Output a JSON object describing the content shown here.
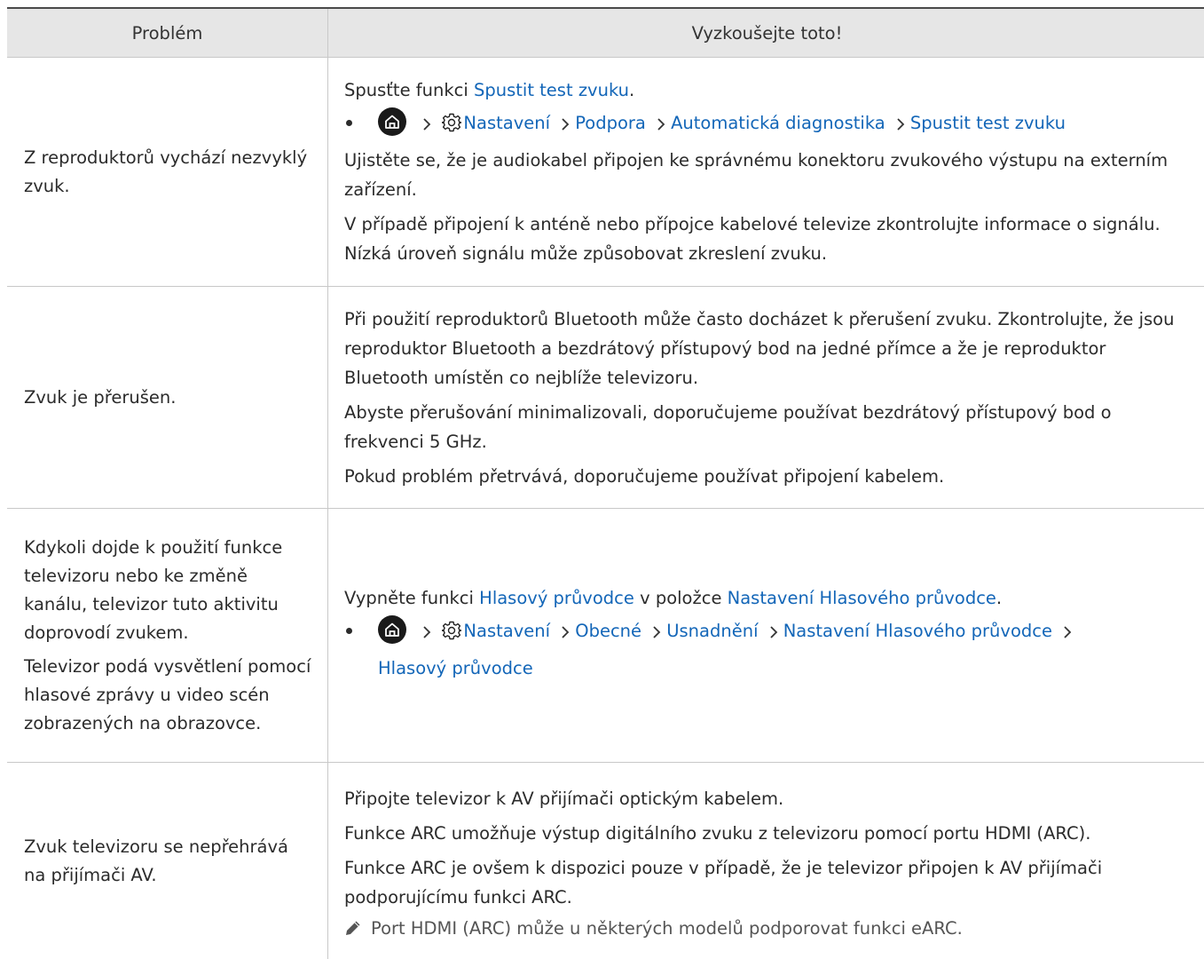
{
  "header": {
    "col1": "Problém",
    "col2": "Vyzkoušejte toto!"
  },
  "rows": [
    {
      "problem": [
        "Z reproduktorů vychází nezvyklý zvuk."
      ],
      "intro": {
        "pre": "Spusťte funkci ",
        "link": "Spustit test zvuku",
        "post": "."
      },
      "path": [
        "Nastavení",
        "Podpora",
        "Automatická diagnostika",
        "Spustit test zvuku"
      ],
      "paragraphs": [
        "Ujistěte se, že je audiokabel připojen ke správnému konektoru zvukového výstupu na externím zařízení.",
        "V případě připojení k anténě nebo přípojce kabelové televize zkontrolujte informace o signálu. Nízká úroveň signálu může způsobovat zkreslení zvuku."
      ]
    },
    {
      "problem": [
        "Zvuk je přerušen."
      ],
      "paragraphs": [
        "Při použití reproduktorů Bluetooth může často docházet k přerušení zvuku. Zkontrolujte, že jsou reproduktor Bluetooth a bezdrátový přístupový bod na jedné přímce a že je reproduktor Bluetooth umístěn co nejblíže televizoru.",
        "Abyste přerušování minimalizovali, doporučujeme používat bezdrátový přístupový bod o frekvenci 5 GHz.",
        "Pokud problém přetrvává, doporučujeme používat připojení kabelem."
      ]
    },
    {
      "problem": [
        "Kdykoli dojde k použití funkce televizoru nebo ke změně kanálu, televizor tuto aktivitu doprovodí zvukem.",
        "Televizor podá vysvětlení pomocí hlasové zprávy u video scén zobrazených na obrazovce."
      ],
      "intro": {
        "pre": "Vypněte funkci ",
        "link": "Hlasový průvodce",
        "mid": " v položce ",
        "link2": "Nastavení Hlasového průvodce",
        "post": "."
      },
      "path": [
        "Nastavení",
        "Obecné",
        "Usnadnění",
        "Nastavení Hlasového průvodce",
        "Hlasový průvodce"
      ]
    },
    {
      "problem": [
        "Zvuk televizoru se nepřehrává na přijímači AV."
      ],
      "paragraphs": [
        "Připojte televizor k AV přijímači optickým kabelem.",
        "Funkce ARC umožňuje výstup digitálního zvuku z televizoru pomocí portu HDMI (ARC).",
        "Funkce ARC je ovšem k dispozici pouze v případě, že je televizor připojen k AV přijímači podporujícímu funkci ARC."
      ],
      "note": "Port HDMI (ARC) může u některých modelů podporovat funkci eARC."
    }
  ],
  "icons": {
    "home": "home-icon",
    "settings": "gear-icon",
    "separator": "chevron-right-icon",
    "note": "pencil-icon"
  },
  "colors": {
    "link": "#1366b8",
    "header_bg": "#e6e6e6",
    "text": "#2b2b2b"
  }
}
